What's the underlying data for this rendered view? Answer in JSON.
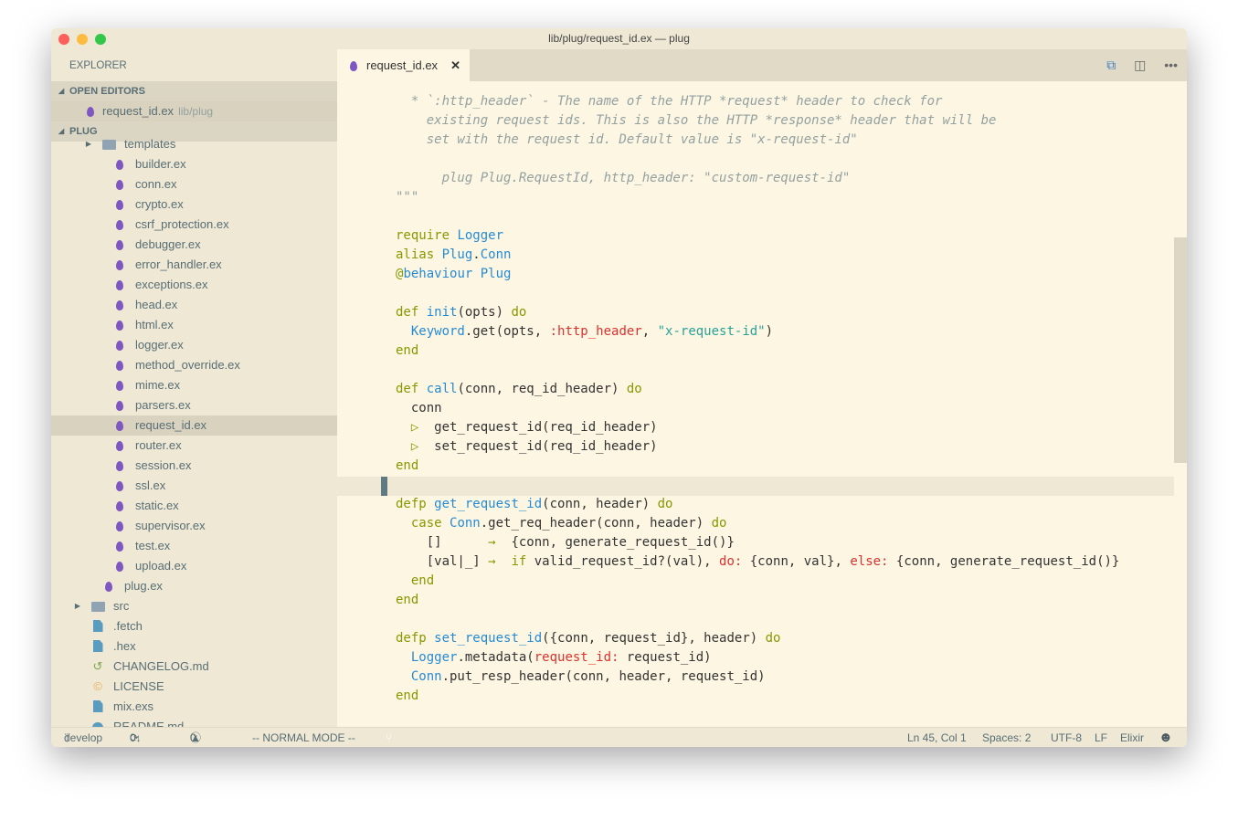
{
  "window": {
    "title": "lib/plug/request_id.ex — plug"
  },
  "sidebar": {
    "title": "EXPLORER",
    "open_editors_label": "OPEN EDITORS",
    "open_editors": [
      {
        "name": "request_id.ex",
        "hint": "lib/plug"
      }
    ],
    "project_label": "PLUG",
    "tree": [
      {
        "name": "templates",
        "type": "folder",
        "indent": 2,
        "cut": true
      },
      {
        "name": "builder.ex",
        "type": "elixir",
        "indent": 3
      },
      {
        "name": "conn.ex",
        "type": "elixir",
        "indent": 3
      },
      {
        "name": "crypto.ex",
        "type": "elixir",
        "indent": 3
      },
      {
        "name": "csrf_protection.ex",
        "type": "elixir",
        "indent": 3
      },
      {
        "name": "debugger.ex",
        "type": "elixir",
        "indent": 3
      },
      {
        "name": "error_handler.ex",
        "type": "elixir",
        "indent": 3
      },
      {
        "name": "exceptions.ex",
        "type": "elixir",
        "indent": 3
      },
      {
        "name": "head.ex",
        "type": "elixir",
        "indent": 3
      },
      {
        "name": "html.ex",
        "type": "elixir",
        "indent": 3
      },
      {
        "name": "logger.ex",
        "type": "elixir",
        "indent": 3
      },
      {
        "name": "method_override.ex",
        "type": "elixir",
        "indent": 3
      },
      {
        "name": "mime.ex",
        "type": "elixir",
        "indent": 3
      },
      {
        "name": "parsers.ex",
        "type": "elixir",
        "indent": 3
      },
      {
        "name": "request_id.ex",
        "type": "elixir",
        "indent": 3,
        "selected": true
      },
      {
        "name": "router.ex",
        "type": "elixir",
        "indent": 3
      },
      {
        "name": "session.ex",
        "type": "elixir",
        "indent": 3
      },
      {
        "name": "ssl.ex",
        "type": "elixir",
        "indent": 3
      },
      {
        "name": "static.ex",
        "type": "elixir",
        "indent": 3
      },
      {
        "name": "supervisor.ex",
        "type": "elixir",
        "indent": 3
      },
      {
        "name": "test.ex",
        "type": "elixir",
        "indent": 3
      },
      {
        "name": "upload.ex",
        "type": "elixir",
        "indent": 3
      },
      {
        "name": "plug.ex",
        "type": "elixir",
        "indent": 2
      },
      {
        "name": "src",
        "type": "folder",
        "indent": 1,
        "collapsed": true
      },
      {
        "name": ".fetch",
        "type": "file",
        "indent": 1
      },
      {
        "name": ".hex",
        "type": "file",
        "indent": 1
      },
      {
        "name": "CHANGELOG.md",
        "type": "changelog",
        "indent": 1
      },
      {
        "name": "LICENSE",
        "type": "license",
        "indent": 1
      },
      {
        "name": "mix.exs",
        "type": "file",
        "indent": 1
      },
      {
        "name": "README.md",
        "type": "info",
        "indent": 1
      }
    ]
  },
  "tab": {
    "label": "request_id.ex",
    "close": "✕"
  },
  "editor_actions": [
    "open-preview-icon",
    "split-editor-icon",
    "more-icon"
  ],
  "code": [
    [
      [
        "  * `:http_header` - The name of the HTTP *request* header to check for",
        "cm"
      ]
    ],
    [
      [
        "    existing request ids. This is also the HTTP *response* header that will be",
        "cm"
      ]
    ],
    [
      [
        "    set with the request id. Default value is \"x-request-id\"",
        "cm"
      ]
    ],
    [],
    [
      [
        "      plug Plug.RequestId, http_header: \"custom-request-id\"",
        "cm"
      ]
    ],
    [
      [
        "\"\"\"",
        "cm"
      ]
    ],
    [],
    [
      [
        "require ",
        "kw"
      ],
      [
        "Logger",
        "ty"
      ]
    ],
    [
      [
        "alias ",
        "kw"
      ],
      [
        "Plug",
        "ty"
      ],
      [
        ".",
        ""
      ],
      [
        "Conn",
        "ty"
      ]
    ],
    [
      [
        "@",
        "kw"
      ],
      [
        "behaviour Plug",
        "ty"
      ]
    ],
    [],
    [
      [
        "def ",
        "kw"
      ],
      [
        "init",
        "ty"
      ],
      [
        "(opts) ",
        ""
      ],
      [
        "do",
        "kw"
      ]
    ],
    [
      [
        "  ",
        ""
      ],
      [
        "Keyword",
        "ty"
      ],
      [
        ".get(opts, ",
        ""
      ],
      [
        ":http_header",
        "at"
      ],
      [
        ", ",
        ""
      ],
      [
        "\"x-request-id\"",
        "st"
      ],
      [
        ")",
        ""
      ]
    ],
    [
      [
        "end",
        "kw"
      ]
    ],
    [],
    [
      [
        "def ",
        "kw"
      ],
      [
        "call",
        "ty"
      ],
      [
        "(conn, req_id_header) ",
        ""
      ],
      [
        "do",
        "kw"
      ]
    ],
    [
      [
        "  conn",
        ""
      ]
    ],
    [
      [
        "  ",
        ""
      ],
      [
        "|>",
        "kw"
      ],
      [
        " get_request_id(req_id_header)",
        ""
      ]
    ],
    [
      [
        "  ",
        ""
      ],
      [
        "|>",
        "kw"
      ],
      [
        " set_request_id(req_id_header)",
        ""
      ]
    ],
    [
      [
        "end",
        "kw"
      ]
    ],
    [],
    [
      [
        "defp ",
        "kw"
      ],
      [
        "get_request_id",
        "ty"
      ],
      [
        "(conn, header) ",
        ""
      ],
      [
        "do",
        "kw"
      ]
    ],
    [
      [
        "  ",
        ""
      ],
      [
        "case ",
        "kw"
      ],
      [
        "Conn",
        "ty"
      ],
      [
        ".get_req_header(conn, header) ",
        ""
      ],
      [
        "do",
        "kw"
      ]
    ],
    [
      [
        "    []      ",
        ""
      ],
      [
        "->",
        "kw"
      ],
      [
        " {conn, generate_request_id()}",
        ""
      ]
    ],
    [
      [
        "    [val|_] ",
        ""
      ],
      [
        "->",
        "kw"
      ],
      [
        " ",
        ""
      ],
      [
        "if",
        "kw"
      ],
      [
        " valid_request_id?(val), ",
        ""
      ],
      [
        "do:",
        "at"
      ],
      [
        " {conn, val}, ",
        ""
      ],
      [
        "else:",
        "at"
      ],
      [
        " {conn, generate_request_id()}",
        ""
      ]
    ],
    [
      [
        "  ",
        ""
      ],
      [
        "end",
        "kw"
      ]
    ],
    [
      [
        "end",
        "kw"
      ]
    ],
    [],
    [
      [
        "defp ",
        "kw"
      ],
      [
        "set_request_id",
        "ty"
      ],
      [
        "({conn, request_id}, header) ",
        ""
      ],
      [
        "do",
        "kw"
      ]
    ],
    [
      [
        "  ",
        ""
      ],
      [
        "Logger",
        "ty"
      ],
      [
        ".metadata(",
        ""
      ],
      [
        "request_id:",
        "at"
      ],
      [
        " request_id)",
        ""
      ]
    ],
    [
      [
        "  ",
        ""
      ],
      [
        "Conn",
        "ty"
      ],
      [
        ".put_resp_header(conn, header, request_id)",
        ""
      ]
    ],
    [
      [
        "end",
        "kw"
      ]
    ]
  ],
  "status": {
    "branch": "develop",
    "sync": "0↓ 7↑",
    "errors": "0",
    "warnings": "0",
    "mode": "-- NORMAL MODE --",
    "position": "Ln 45, Col 1",
    "spaces": "Spaces: 2",
    "encoding": "UTF-8",
    "eol": "LF",
    "language": "Elixir"
  },
  "colors": {
    "elixir": "#7e57c2",
    "keyword": "#859900",
    "type": "#268bd2",
    "atom": "#dc322f",
    "string": "#2aa198",
    "comment": "#93a1a1"
  }
}
